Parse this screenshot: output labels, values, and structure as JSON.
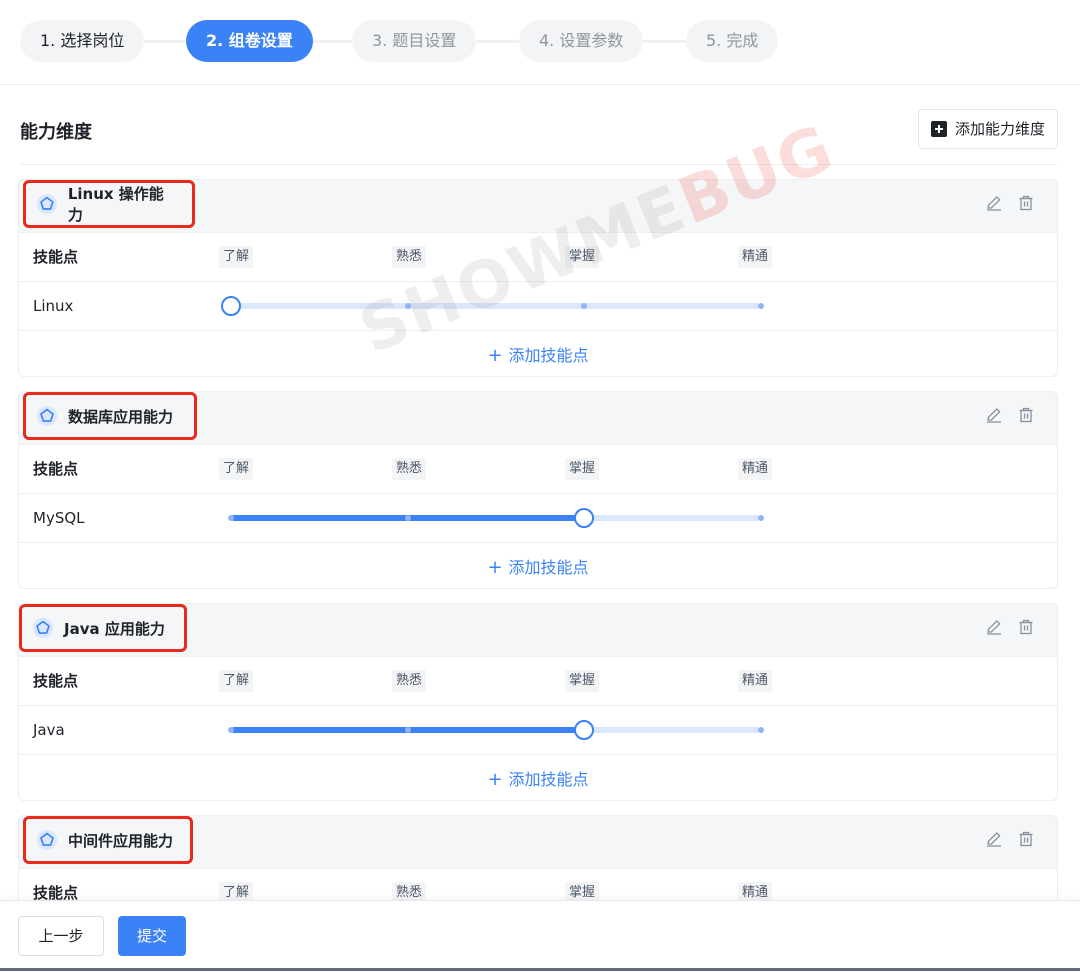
{
  "steps": [
    {
      "label": "1. 选择岗位",
      "state": "done"
    },
    {
      "label": "2. 组卷设置",
      "state": "active"
    },
    {
      "label": "3. 题目设置",
      "state": "pending"
    },
    {
      "label": "4. 设置参数",
      "state": "pending"
    },
    {
      "label": "5. 完成",
      "state": "pending"
    }
  ],
  "section": {
    "title": "能力维度",
    "add_dimension_label": "添加能力维度"
  },
  "table_header": {
    "skill_col": "技能点",
    "levels": [
      "了解",
      "熟悉",
      "掌握",
      "精通"
    ]
  },
  "add_skill_label": "添加技能点",
  "dimensions": [
    {
      "title": "Linux 操作能力",
      "skills": [
        {
          "name": "Linux",
          "level_index": 0,
          "level": "了解"
        }
      ]
    },
    {
      "title": "数据库应用能力",
      "skills": [
        {
          "name": "MySQL",
          "level_index": 2,
          "level": "掌握"
        }
      ]
    },
    {
      "title": "Java 应用能力",
      "skills": [
        {
          "name": "Java",
          "level_index": 2,
          "level": "掌握"
        }
      ]
    },
    {
      "title": "中间件应用能力",
      "skills": []
    }
  ],
  "watermark": {
    "text": "SHOWME",
    "accent": "BUG"
  },
  "footer": {
    "prev_label": "上一步",
    "submit_label": "提交"
  },
  "colors": {
    "primary": "#3b82f6",
    "highlight_border": "#e8291d"
  },
  "icons": {
    "dimension": "pentagon-icon",
    "edit": "pencil-icon",
    "delete": "trash-icon",
    "add": "plus-icon"
  }
}
